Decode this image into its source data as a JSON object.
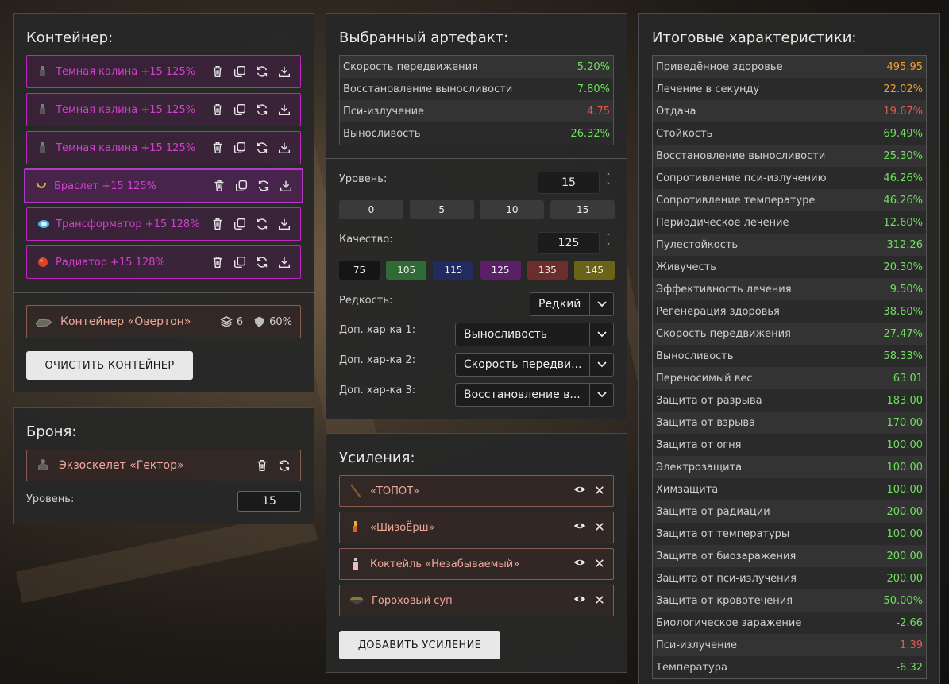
{
  "container": {
    "title": "Контейнер:",
    "items": [
      {
        "label": "Темная калина +15 125%",
        "icon": "kalina-icon"
      },
      {
        "label": "Темная калина +15 125%",
        "icon": "kalina-icon"
      },
      {
        "label": "Темная калина +15 125%",
        "icon": "kalina-icon"
      },
      {
        "label": "Браслет +15 125%",
        "icon": "bracelet-icon"
      },
      {
        "label": "Трансформатор +15 128%",
        "icon": "transformer-icon"
      },
      {
        "label": "Радиатор +15 128%",
        "icon": "radiator-icon"
      }
    ],
    "box": {
      "label": "Контейнер «Овертон»",
      "slots": "6",
      "protection": "60%"
    },
    "clear_label": "ОЧИСТИТЬ КОНТЕЙНЕР"
  },
  "armor": {
    "title": "Броня:",
    "item": "Экзоскелет «Гектор»",
    "level_label": "Уровень:",
    "level_value": "15"
  },
  "artifact": {
    "title": "Выбранный артефакт:",
    "stats": [
      {
        "name": "Скорость передвижения",
        "value": "5.20%",
        "tone": "green"
      },
      {
        "name": "Восстановление выносливости",
        "value": "7.80%",
        "tone": "green"
      },
      {
        "name": "Пси-излучение",
        "value": "4.75",
        "tone": "red"
      },
      {
        "name": "Выносливость",
        "value": "26.32%",
        "tone": "green"
      }
    ],
    "level_label": "Уровень:",
    "level_value": "15",
    "level_presets": [
      "0",
      "5",
      "10",
      "15"
    ],
    "quality_label": "Качество:",
    "quality_value": "125",
    "quality_presets": [
      {
        "label": "75",
        "color": "#151515"
      },
      {
        "label": "105",
        "color": "#2f6b35"
      },
      {
        "label": "115",
        "color": "#222a62"
      },
      {
        "label": "125",
        "color": "#5a1f66"
      },
      {
        "label": "135",
        "color": "#6b2e2b"
      },
      {
        "label": "145",
        "color": "#6b6418"
      }
    ],
    "rarity_label": "Редкость:",
    "rarity_value": "Редкий",
    "extra1_label": "Доп. хар-ка 1:",
    "extra1_value": "Выносливость",
    "extra2_label": "Доп. хар-ка 2:",
    "extra2_value": "Скорость передви...",
    "extra3_label": "Доп. хар-ка 3:",
    "extra3_value": "Восстановление в..."
  },
  "boosts": {
    "title": "Усиления:",
    "items": [
      {
        "label": "«ТОПОТ»",
        "icon": "stick-icon"
      },
      {
        "label": "«ШизоЁрш»",
        "icon": "syringe-icon"
      },
      {
        "label": "Коктейль «Незабываемый»",
        "icon": "bottle-icon"
      },
      {
        "label": "Гороховый суп",
        "icon": "soup-icon"
      }
    ],
    "add_label": "ДОБАВИТЬ УСИЛЕНИЕ"
  },
  "totals": {
    "title": "Итоговые характеристики:",
    "stats": [
      {
        "name": "Приведённое здоровье",
        "value": "495.95",
        "tone": "orange"
      },
      {
        "name": "Лечение в секунду",
        "value": "22.02%",
        "tone": "orange"
      },
      {
        "name": "Отдача",
        "value": "19.67%",
        "tone": "red"
      },
      {
        "name": "Стойкость",
        "value": "69.49%",
        "tone": "green"
      },
      {
        "name": "Восстановление выносливости",
        "value": "25.30%",
        "tone": "green"
      },
      {
        "name": "Сопротивление пси-излучению",
        "value": "46.26%",
        "tone": "green"
      },
      {
        "name": "Сопротивление температуре",
        "value": "46.26%",
        "tone": "green"
      },
      {
        "name": "Периодическое лечение",
        "value": "12.60%",
        "tone": "green"
      },
      {
        "name": "Пулестойкость",
        "value": "312.26",
        "tone": "green"
      },
      {
        "name": "Живучесть",
        "value": "20.30%",
        "tone": "green"
      },
      {
        "name": "Эффективность лечения",
        "value": "9.50%",
        "tone": "green"
      },
      {
        "name": "Регенерация здоровья",
        "value": "38.60%",
        "tone": "green"
      },
      {
        "name": "Скорость передвижения",
        "value": "27.47%",
        "tone": "green"
      },
      {
        "name": "Выносливость",
        "value": "58.33%",
        "tone": "green"
      },
      {
        "name": "Переносимый вес",
        "value": "63.01",
        "tone": "green"
      },
      {
        "name": "Защита от разрыва",
        "value": "183.00",
        "tone": "green"
      },
      {
        "name": "Защита от взрыва",
        "value": "170.00",
        "tone": "green"
      },
      {
        "name": "Защита от огня",
        "value": "100.00",
        "tone": "green"
      },
      {
        "name": "Электрозащита",
        "value": "100.00",
        "tone": "green"
      },
      {
        "name": "Химзащита",
        "value": "100.00",
        "tone": "green"
      },
      {
        "name": "Защита от радиации",
        "value": "200.00",
        "tone": "green"
      },
      {
        "name": "Защита от температуры",
        "value": "100.00",
        "tone": "green"
      },
      {
        "name": "Защита от биозаражения",
        "value": "200.00",
        "tone": "green"
      },
      {
        "name": "Защита от пси-излучения",
        "value": "200.00",
        "tone": "green"
      },
      {
        "name": "Защита от кровотечения",
        "value": "50.00%",
        "tone": "green"
      },
      {
        "name": "Биологическое заражение",
        "value": "-2.66",
        "tone": "green"
      },
      {
        "name": "Пси-излучение",
        "value": "1.39",
        "tone": "red"
      },
      {
        "name": "Температура",
        "value": "-6.32",
        "tone": "green"
      }
    ]
  }
}
